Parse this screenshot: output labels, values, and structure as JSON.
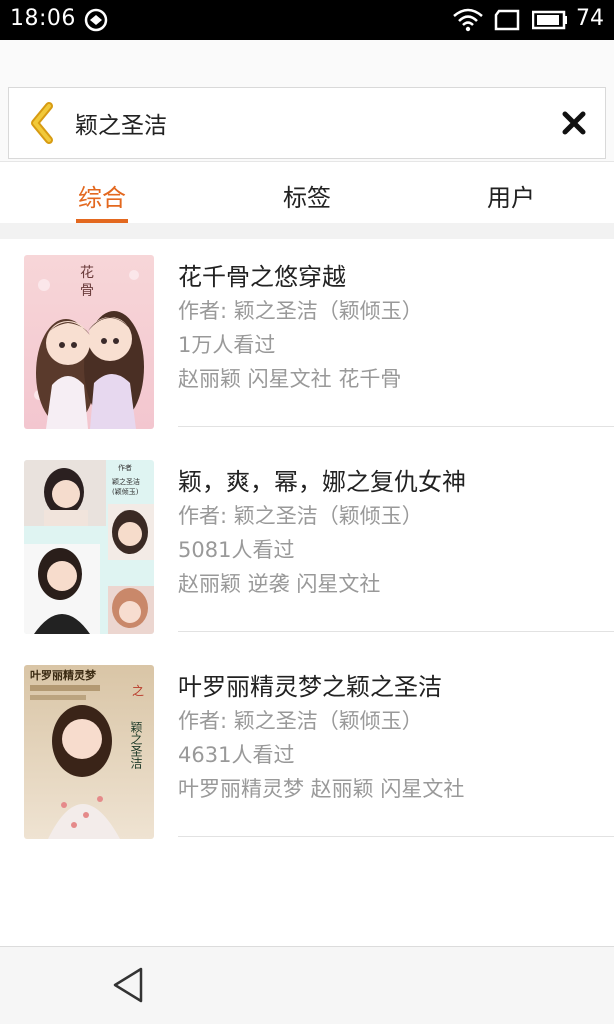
{
  "status_bar": {
    "time": "18:06",
    "battery_level": "74"
  },
  "search": {
    "query": "颖之圣洁"
  },
  "tabs": [
    {
      "label": "综合",
      "active": true
    },
    {
      "label": "标签",
      "active": false
    },
    {
      "label": "用户",
      "active": false
    }
  ],
  "results": [
    {
      "title": "花千骨之悠穿越",
      "author": "作者: 颖之圣洁（颖倾玉）",
      "views": "1万人看过",
      "tags": "赵丽颖 闪星文社 花千骨"
    },
    {
      "title": "颖，爽，幂，娜之复仇女神",
      "author": "作者: 颖之圣洁（颖倾玉）",
      "views": "5081人看过",
      "tags": "赵丽颖 逆袭 闪星文社",
      "cover_text": [
        "作者",
        "颖之圣洁",
        "(颖倾玉)"
      ]
    },
    {
      "title": "叶罗丽精灵梦之颖之圣洁",
      "author": "作者: 颖之圣洁（颖倾玉）",
      "views": "4631人看过",
      "tags": "叶罗丽精灵梦 赵丽颖 闪星文社",
      "cover_text": [
        "叶罗丽精灵梦",
        "之",
        "颖之圣洁"
      ]
    }
  ],
  "colors": {
    "accent": "#e3681f",
    "secondary_text": "#999999",
    "back_arrow": "#e8b41c"
  },
  "icons": {
    "back": "chevron-left-icon",
    "clear": "close-icon",
    "nav_back": "triangle-back-icon"
  }
}
